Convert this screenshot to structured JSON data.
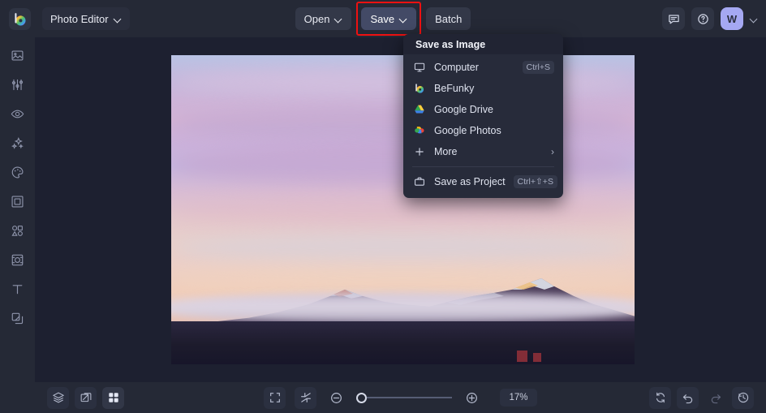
{
  "app": {
    "logo_icon": "befunky-logo-icon",
    "workspace_label": "Photo Editor"
  },
  "header": {
    "open_label": "Open",
    "save_label": "Save",
    "batch_label": "Batch",
    "feedback_icon": "chat-bubble-icon",
    "help_icon": "question-circle-icon",
    "avatar_initial": "W",
    "save_highlight_color": "#ee1111",
    "save_active_color": "#434a66",
    "avatar_color": "#a5a8f2"
  },
  "sidebar": {
    "items": [
      {
        "name": "sidebar-item-edit",
        "icon": "image-edit-icon"
      },
      {
        "name": "sidebar-item-adjust",
        "icon": "sliders-icon"
      },
      {
        "name": "sidebar-item-retouch",
        "icon": "eye-icon"
      },
      {
        "name": "sidebar-item-effects",
        "icon": "sparkles-icon"
      },
      {
        "name": "sidebar-item-artsy",
        "icon": "palette-icon"
      },
      {
        "name": "sidebar-item-frames",
        "icon": "frame-icon"
      },
      {
        "name": "sidebar-item-graphics",
        "icon": "shapes-icon"
      },
      {
        "name": "sidebar-item-overlays",
        "icon": "overlay-icon"
      },
      {
        "name": "sidebar-item-text",
        "icon": "text-icon"
      },
      {
        "name": "sidebar-item-textures",
        "icon": "layers-texture-icon"
      }
    ]
  },
  "menu": {
    "title": "Save as Image",
    "items": [
      {
        "label": "Computer",
        "icon": "monitor-icon",
        "shortcut": "Ctrl+S",
        "submenu": false
      },
      {
        "label": "BeFunky",
        "icon": "befunky-logo-icon",
        "shortcut": "",
        "submenu": false
      },
      {
        "label": "Google Drive",
        "icon": "google-drive-icon",
        "shortcut": "",
        "submenu": false
      },
      {
        "label": "Google Photos",
        "icon": "google-photos-icon",
        "shortcut": "",
        "submenu": false
      },
      {
        "label": "More",
        "icon": "plus-icon",
        "shortcut": "",
        "submenu": true
      }
    ],
    "project_item": {
      "label": "Save as Project",
      "icon": "briefcase-icon",
      "shortcut": "Ctrl+⇧+S"
    },
    "submenu_arrow": "›"
  },
  "bottom": {
    "layers_icon": "layers-icon",
    "compare_icon": "compare-icon",
    "grid_icon": "grid-icon",
    "fitscreen_icon": "fit-screen-icon",
    "actualsize_icon": "shrink-icon",
    "zoom_out_icon": "minus-circle-icon",
    "zoom_in_icon": "plus-circle-icon",
    "zoom_value": "17%",
    "reset_icon": "rotate-icon",
    "undo_icon": "undo-icon",
    "redo_icon": "redo-icon",
    "history_icon": "history-icon"
  },
  "canvas": {
    "image_alt": "sunset-mountain-photo"
  }
}
